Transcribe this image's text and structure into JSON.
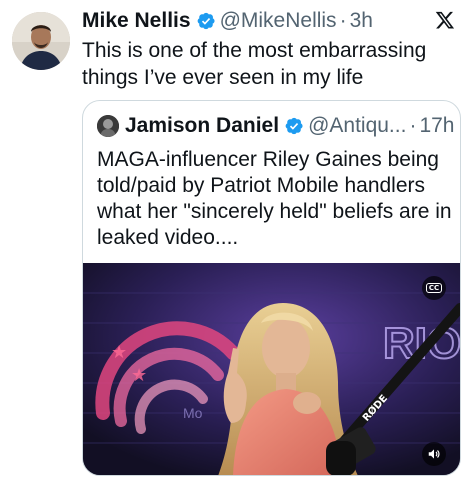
{
  "tweet": {
    "author_name": "Mike Nellis",
    "handle": "@MikeNellis",
    "separator": "·",
    "time": "3h",
    "text": "This is one of the most embarrassing things I’ve ever seen in my life"
  },
  "quoted_tweet": {
    "author_name": "Jamison Daniel",
    "handle": "@Antiqu...",
    "separator": "·",
    "time": "17h",
    "text": "MAGA-influencer Riley Gaines being told/paid by Patriot Mobile handlers what her \"sincerely held\" beliefs are in leaked video....",
    "video": {
      "backdrop_text": "RIOT",
      "backdrop_text_2": "Mo",
      "mic_brand": "RØDE",
      "cc_label": "CC"
    }
  },
  "icons": {
    "verified": "verified-badge-icon",
    "platform": "x-logo-icon",
    "captions": "closed-captions-icon",
    "sound": "volume-icon"
  },
  "colors": {
    "verified_blue": "#1d9bf0",
    "secondary_text": "#536471",
    "border": "#cfd9de"
  }
}
